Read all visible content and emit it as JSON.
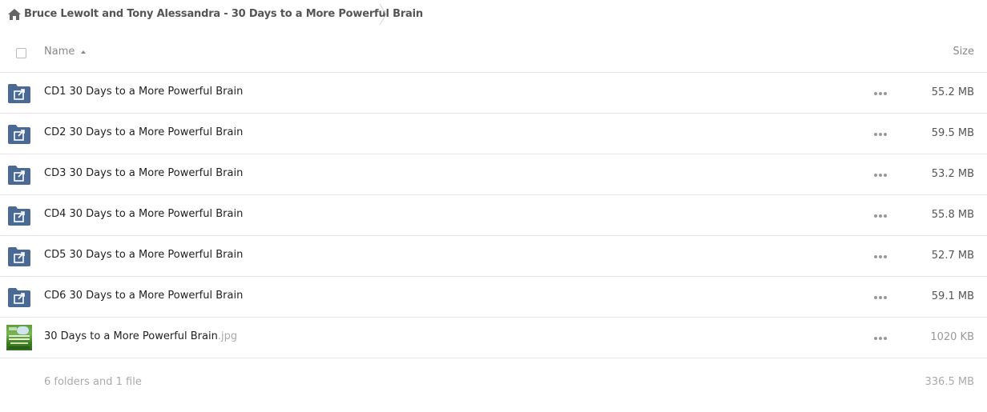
{
  "breadcrumb": {
    "home_icon": "home-icon",
    "title": "Bruce Lewolt and Tony Alessandra - 30 Days to a More Powerful Brain"
  },
  "header": {
    "name_label": "Name",
    "size_label": "Size",
    "sort": "ascending"
  },
  "files": [
    {
      "name": "CD1 30 Days to a More Powerful Brain",
      "ext": "",
      "size": "55.2 MB",
      "type": "shared-folder"
    },
    {
      "name": "CD2 30 Days to a More Powerful Brain",
      "ext": "",
      "size": "59.5 MB",
      "type": "shared-folder"
    },
    {
      "name": "CD3 30 Days to a More Powerful Brain",
      "ext": "",
      "size": "53.2 MB",
      "type": "shared-folder"
    },
    {
      "name": "CD4 30 Days to a More Powerful Brain",
      "ext": "",
      "size": "55.8 MB",
      "type": "shared-folder"
    },
    {
      "name": "CD5 30 Days to a More Powerful Brain",
      "ext": "",
      "size": "52.7 MB",
      "type": "shared-folder"
    },
    {
      "name": "CD6 30 Days to a More Powerful Brain",
      "ext": "",
      "size": "59.1 MB",
      "type": "shared-folder"
    },
    {
      "name": "30 Days to a More Powerful Brain",
      "ext": ".jpg",
      "size": "1020 KB",
      "type": "image"
    }
  ],
  "summary": {
    "text": "6 folders and 1 file",
    "total_size": "336.5 MB"
  },
  "colors": {
    "folder": "#4a6a93",
    "divider": "#e6e6e6"
  }
}
